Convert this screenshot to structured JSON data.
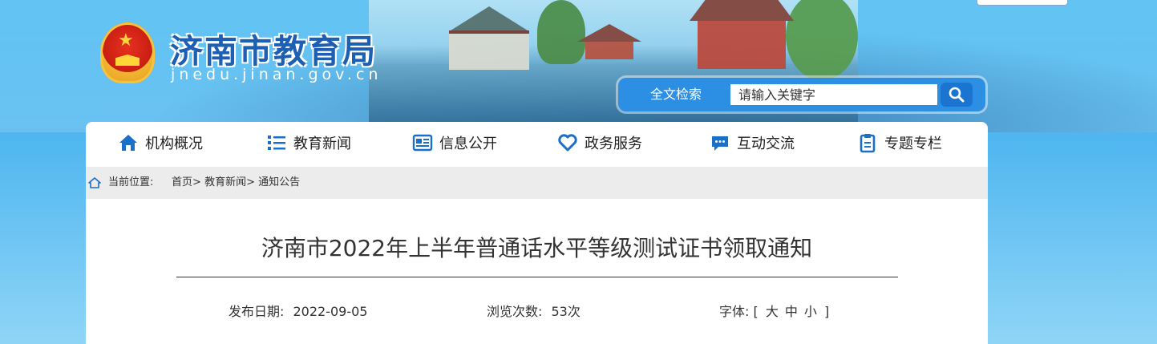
{
  "header": {
    "site_title": "济南市教育局",
    "site_domain": "jnedu.jinan.gov.cn"
  },
  "search": {
    "label": "全文检索",
    "placeholder": "请输入关键字"
  },
  "nav": {
    "items": [
      {
        "label": "机构概况",
        "icon": "home-icon"
      },
      {
        "label": "教育新闻",
        "icon": "list-icon"
      },
      {
        "label": "信息公开",
        "icon": "newspaper-icon"
      },
      {
        "label": "政务服务",
        "icon": "heart-icon"
      },
      {
        "label": "互动交流",
        "icon": "chat-icon"
      },
      {
        "label": "专题专栏",
        "icon": "clipboard-icon"
      }
    ]
  },
  "breadcrumb": {
    "label": "当前位置:",
    "items": [
      "首页",
      "教育新闻",
      "通知公告"
    ],
    "separator": ">"
  },
  "article": {
    "title": "济南市2022年上半年普通话水平等级测试证书领取通知",
    "publish_label": "发布日期:",
    "publish_date": "2022-09-05",
    "views_label": "浏览次数:",
    "views_value": "53次",
    "font_label": "字体:",
    "font_open": "[",
    "font_sizes": [
      "大",
      "中",
      "小"
    ],
    "font_close": "]"
  },
  "colors": {
    "brand_blue": "#1d5fb3",
    "search_blue": "#2d8fe3",
    "nav_icon_blue": "#1a6fc9"
  }
}
